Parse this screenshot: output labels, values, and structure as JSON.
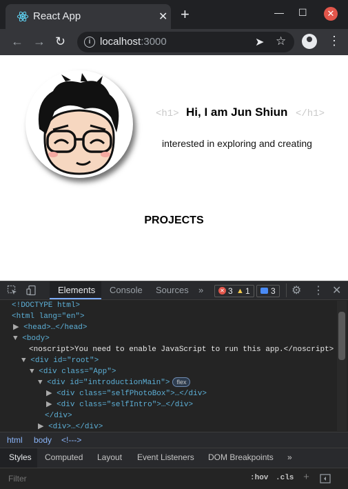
{
  "browser": {
    "tab_title": "React App",
    "tab_close": "✕",
    "new_tab": "+",
    "url_host": "localhost",
    "url_port": ":3000",
    "window": {
      "minimize": "—",
      "maximize": "☐",
      "close": "✕"
    }
  },
  "page": {
    "h1_open": "<h1>",
    "title": "Hi, I am Jun Shiun",
    "h1_close": "</h1>",
    "subtitle": "interested in exploring and creating",
    "projects_heading": "PROJECTS"
  },
  "devtools": {
    "tabs": [
      "Elements",
      "Console",
      "Sources",
      "»"
    ],
    "errors": "3",
    "warnings": "1",
    "messages": "3",
    "dom_lines": [
      "<!DOCTYPE html>",
      "<html lang=\"en\">",
      "<head>…</head>",
      "<body>",
      "<noscript>You need to enable JavaScript to run this app.</noscript>",
      "<div id=\"root\">",
      "<div class=\"App\">",
      "<div id=\"introductionMain\">",
      "<div class=\"selfPhotoBox\">…</div>",
      "<div class=\"selfIntro\">…</div>",
      "</div>",
      "<div>…</div>"
    ],
    "flex_badge": "flex",
    "breadcrumb": [
      "html",
      "body",
      "<!--->"
    ],
    "style_tabs": [
      "Styles",
      "Computed",
      "Layout",
      "Event Listeners",
      "DOM Breakpoints",
      "»"
    ],
    "filter_placeholder": "Filter",
    "hov": ":hov",
    "cls": ".cls",
    "plus": "+"
  },
  "colors": {
    "accent": "#7cacf8",
    "error": "#e2564b",
    "warning": "#f2c94c",
    "tag": "#5db0d7",
    "value": "#f29766"
  }
}
